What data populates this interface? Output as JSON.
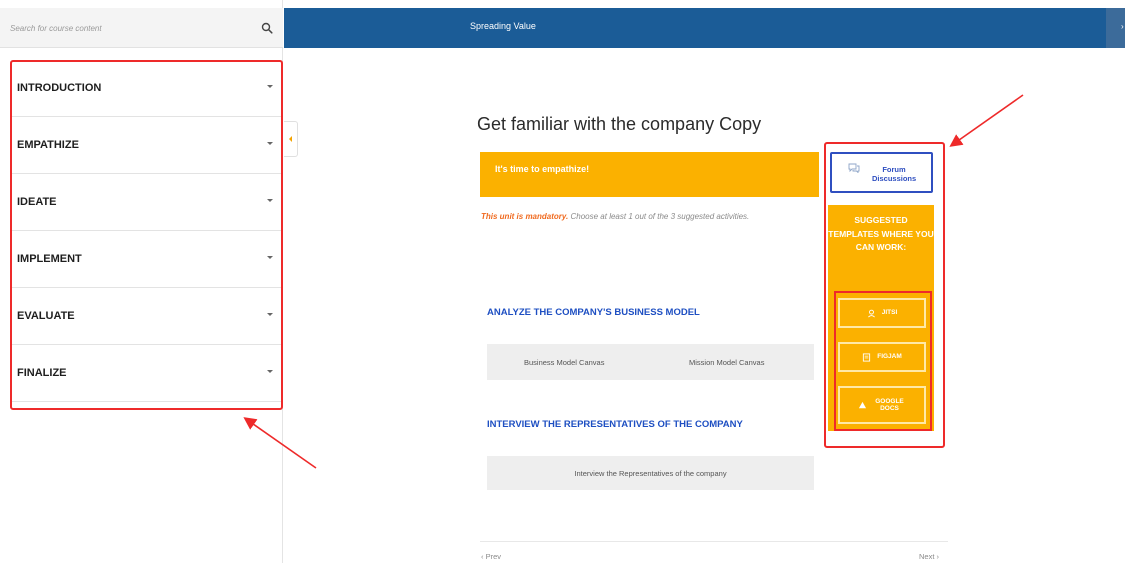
{
  "sidebar": {
    "search_placeholder": "Search for course content",
    "sections": [
      {
        "label": "INTRODUCTION"
      },
      {
        "label": "EMPATHIZE"
      },
      {
        "label": "IDEATE"
      },
      {
        "label": "IMPLEMENT"
      },
      {
        "label": "EVALUATE"
      },
      {
        "label": "FINALIZE"
      }
    ]
  },
  "topbar": {
    "title": "Spreading Value",
    "right_glyph": "›"
  },
  "main": {
    "title": "Get familiar with the company Copy",
    "banner": "It's time to empathize!",
    "mandatory_strong": "This unit is mandatory.",
    "mandatory_rest": " Choose at least 1 out of the 3 suggested activities.",
    "activities": [
      {
        "heading": "ANALYZE THE COMPANY'S BUSINESS MODEL",
        "items": [
          "Business Model Canvas",
          "Mission Model Canvas"
        ]
      },
      {
        "heading": "INTERVIEW THE REPRESENTATIVES OF THE COMPANY",
        "items": [
          "Interview the Representatives of the company"
        ]
      }
    ],
    "prev": "‹ Prev",
    "next": "Next ›"
  },
  "right_panel": {
    "forum_label": "Forum Discussions",
    "templates_heading": "SUGGESTED TEMPLATES WHERE YOU CAN WORK:",
    "templates": [
      {
        "label": "JITSI",
        "icon": "jitsi-icon"
      },
      {
        "label": "FIGJAM",
        "icon": "figjam-icon"
      },
      {
        "label": "GOOGLE DOCS",
        "icon": "google-docs-icon"
      }
    ]
  },
  "colors": {
    "topbar": "#1b5c97",
    "accent_orange": "#fbb100",
    "highlight_red": "#ee2a2a",
    "link_blue": "#1e4fc2"
  }
}
